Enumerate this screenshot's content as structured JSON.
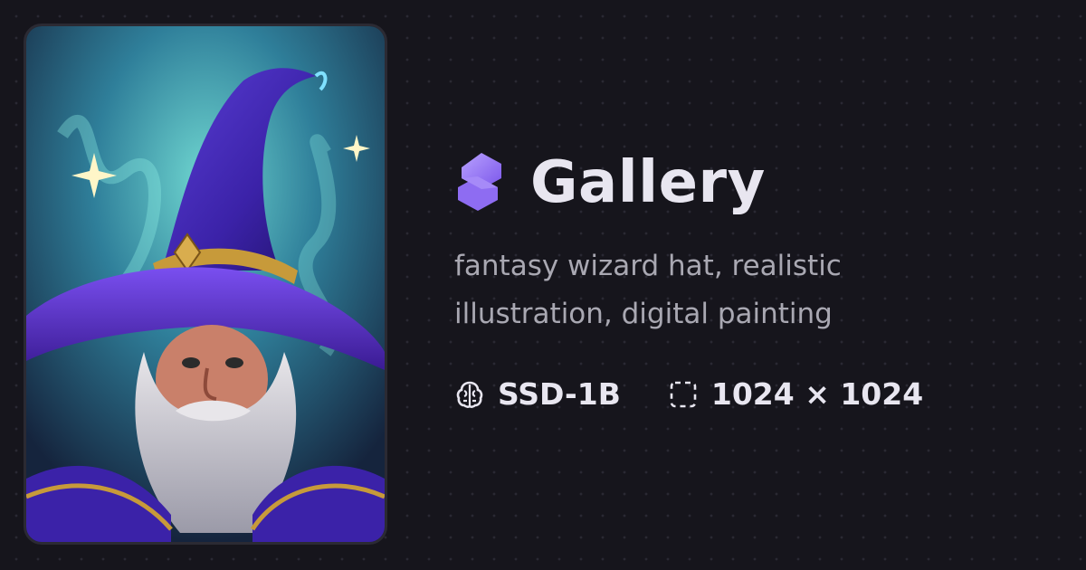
{
  "header": {
    "title": "Gallery",
    "logo_icon": "stacked-cube-logo-icon"
  },
  "image": {
    "alt": "wizard-portrait"
  },
  "prompt": {
    "text": "fantasy wizard hat, realistic illustration, digital painting"
  },
  "meta": {
    "model": "SSD-1B",
    "model_icon": "brain-icon",
    "dimensions": "1024 × 1024",
    "dimensions_icon": "dashed-frame-icon"
  },
  "colors": {
    "background": "#16151c",
    "accent": "#8b6cf0",
    "text_primary": "#e8e6f0",
    "text_secondary": "#a9a8b2"
  }
}
